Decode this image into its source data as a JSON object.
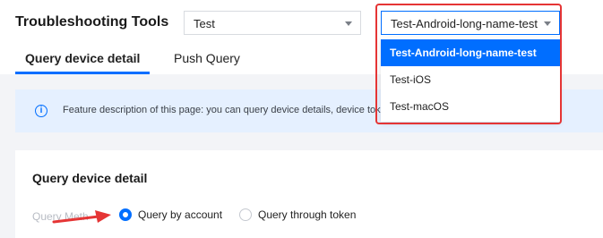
{
  "header": {
    "title": "Troubleshooting Tools",
    "app_select": {
      "value": "Test"
    },
    "env_select": {
      "value": "Test-Android-long-name-test"
    }
  },
  "tabs": [
    {
      "label": "Query device detail",
      "active": true
    },
    {
      "label": "Push Query",
      "active": false
    }
  ],
  "info_bar": {
    "icon": "info-icon",
    "text": "Feature description of this page: you can query device details, device tokens, bound accounts and push tag throu"
  },
  "panel": {
    "title": "Query device detail",
    "method_label": "Query Meth",
    "options": [
      {
        "label": "Query by account",
        "checked": true
      },
      {
        "label": "Query through token",
        "checked": false
      }
    ]
  },
  "dropdown": {
    "options": [
      "Test-Android-long-name-test",
      "Test-iOS",
      "Test-macOS"
    ],
    "selected": "Test-Android-long-name-test"
  },
  "colors": {
    "accent": "#006eff",
    "highlight": "#e53535",
    "info_bg": "#e5f0ff"
  }
}
